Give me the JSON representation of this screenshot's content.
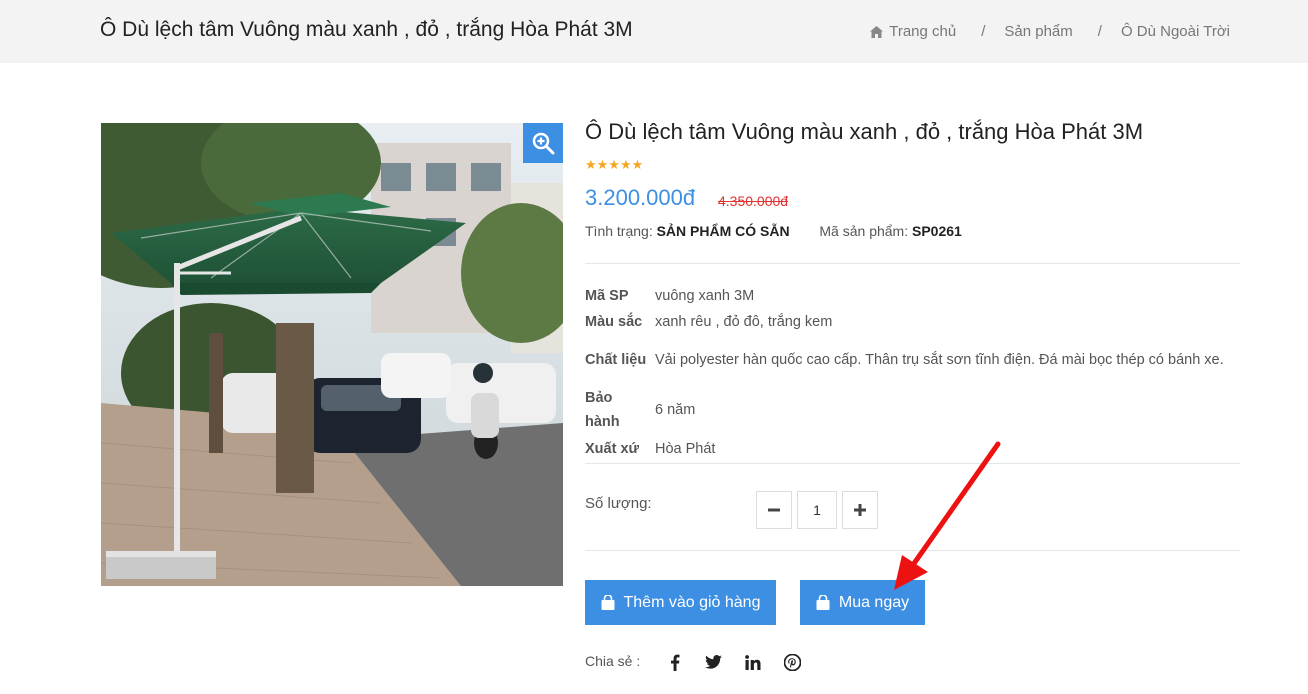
{
  "header": {
    "title": "Ô Dù lệch tâm Vuông màu xanh , đỏ , trắng Hòa Phát 3M",
    "breadcrumb": {
      "home": "Trang chủ",
      "sep1": "/",
      "category": "Sản phẩm",
      "sep2": "/",
      "subcategory": "Ô Dù Ngoài Trời"
    }
  },
  "product": {
    "name": "Ô Dù lệch tâm Vuông màu xanh , đỏ , trắng Hòa Phát 3M",
    "rating": 5,
    "rating_stars": "★★★★★",
    "price": "3.200.000đ",
    "old_price": "4.350.000đ",
    "status_label": "Tình trạng:",
    "status_value": "SẢN PHẨM CÓ SẴN",
    "sku_label": "Mã sản phẩm:",
    "sku_value": "SP0261",
    "specs": [
      {
        "key": "Mã SP",
        "value": "vuông xanh 3M"
      },
      {
        "key": "Màu sắc",
        "value": "xanh rêu , đỏ đô, trắng kem"
      },
      {
        "key": "Chất liệu",
        "value": "Vải polyester hàn quốc cao cấp. Thân trụ sắt sơn tĩnh điện. Đá mài bọc thép có bánh xe."
      },
      {
        "key": "Bảo hành",
        "value": "6 năm"
      },
      {
        "key": "Xuất xứ",
        "value": "Hòa Phát"
      }
    ]
  },
  "quantity": {
    "label": "Số lượng:",
    "value": "1"
  },
  "actions": {
    "add_to_cart": "Thêm vào giỏ hàng",
    "buy_now": "Mua ngay"
  },
  "share": {
    "label": "Chia sẻ :",
    "networks": [
      "facebook-icon",
      "twitter-icon",
      "linkedin-icon",
      "pinterest-icon"
    ]
  },
  "colors": {
    "accent": "#3d8fe3",
    "old_price": "#e03131",
    "stars": "#f5a623",
    "annotation_arrow": "#ee1111"
  },
  "icons": {
    "home": "home-icon",
    "zoom": "zoom-in-icon",
    "minus": "minus-icon",
    "plus": "plus-icon",
    "bag": "shopping-bag-icon"
  }
}
